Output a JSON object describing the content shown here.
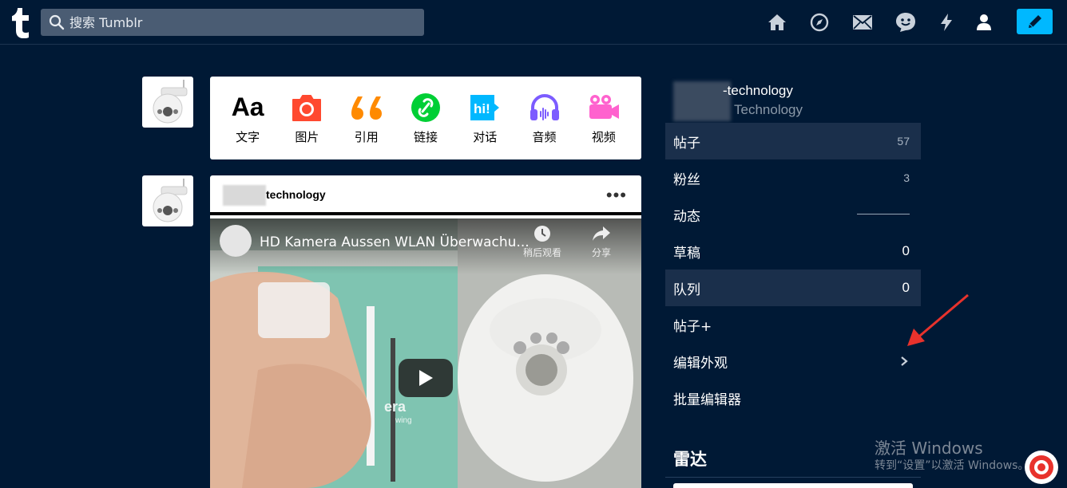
{
  "header": {
    "search_placeholder": "搜索 Tumblr"
  },
  "post_types": [
    {
      "label": "文字",
      "icon": "text-aa-icon",
      "color": "#000000"
    },
    {
      "label": "图片",
      "icon": "camera-icon",
      "color": "#ff492f"
    },
    {
      "label": "引用",
      "icon": "quote-icon",
      "color": "#ff8a00"
    },
    {
      "label": "链接",
      "icon": "link-icon",
      "color": "#00cf35"
    },
    {
      "label": "对话",
      "icon": "chat-icon",
      "color": "#00b8ff"
    },
    {
      "label": "音频",
      "icon": "headphones-icon",
      "color": "#7c5cff"
    },
    {
      "label": "视频",
      "icon": "video-camera-icon",
      "color": "#ff62ce"
    }
  ],
  "post": {
    "blog_name": "technology",
    "more_label": "•••",
    "video_title": "HD Kamera Aussen WLAN Überwachu...",
    "watch_later": "稍后观看",
    "share": "分享",
    "box_text": "era",
    "box_subtext": "wing"
  },
  "sidebar": {
    "blog_title": "-technology",
    "blog_subtitle": "Technology",
    "items": [
      {
        "label": "帖子",
        "count": "57"
      },
      {
        "label": "粉丝",
        "count": "3"
      },
      {
        "label": "动态"
      },
      {
        "label": "草稿",
        "count": "0"
      },
      {
        "label": "队列",
        "count": "0"
      },
      {
        "label": "帖子+"
      },
      {
        "label": "编辑外观"
      },
      {
        "label": "批量编辑器"
      }
    ],
    "radar_title": "雷达"
  },
  "watermark": {
    "line1": "激活 Windows",
    "line2": "转到“设置”以激活 Windows。"
  },
  "colors": {
    "background": "#001935",
    "accent": "#00b8ff",
    "highlight_row": "#1a2f4b",
    "arrow": "#e8322c"
  }
}
